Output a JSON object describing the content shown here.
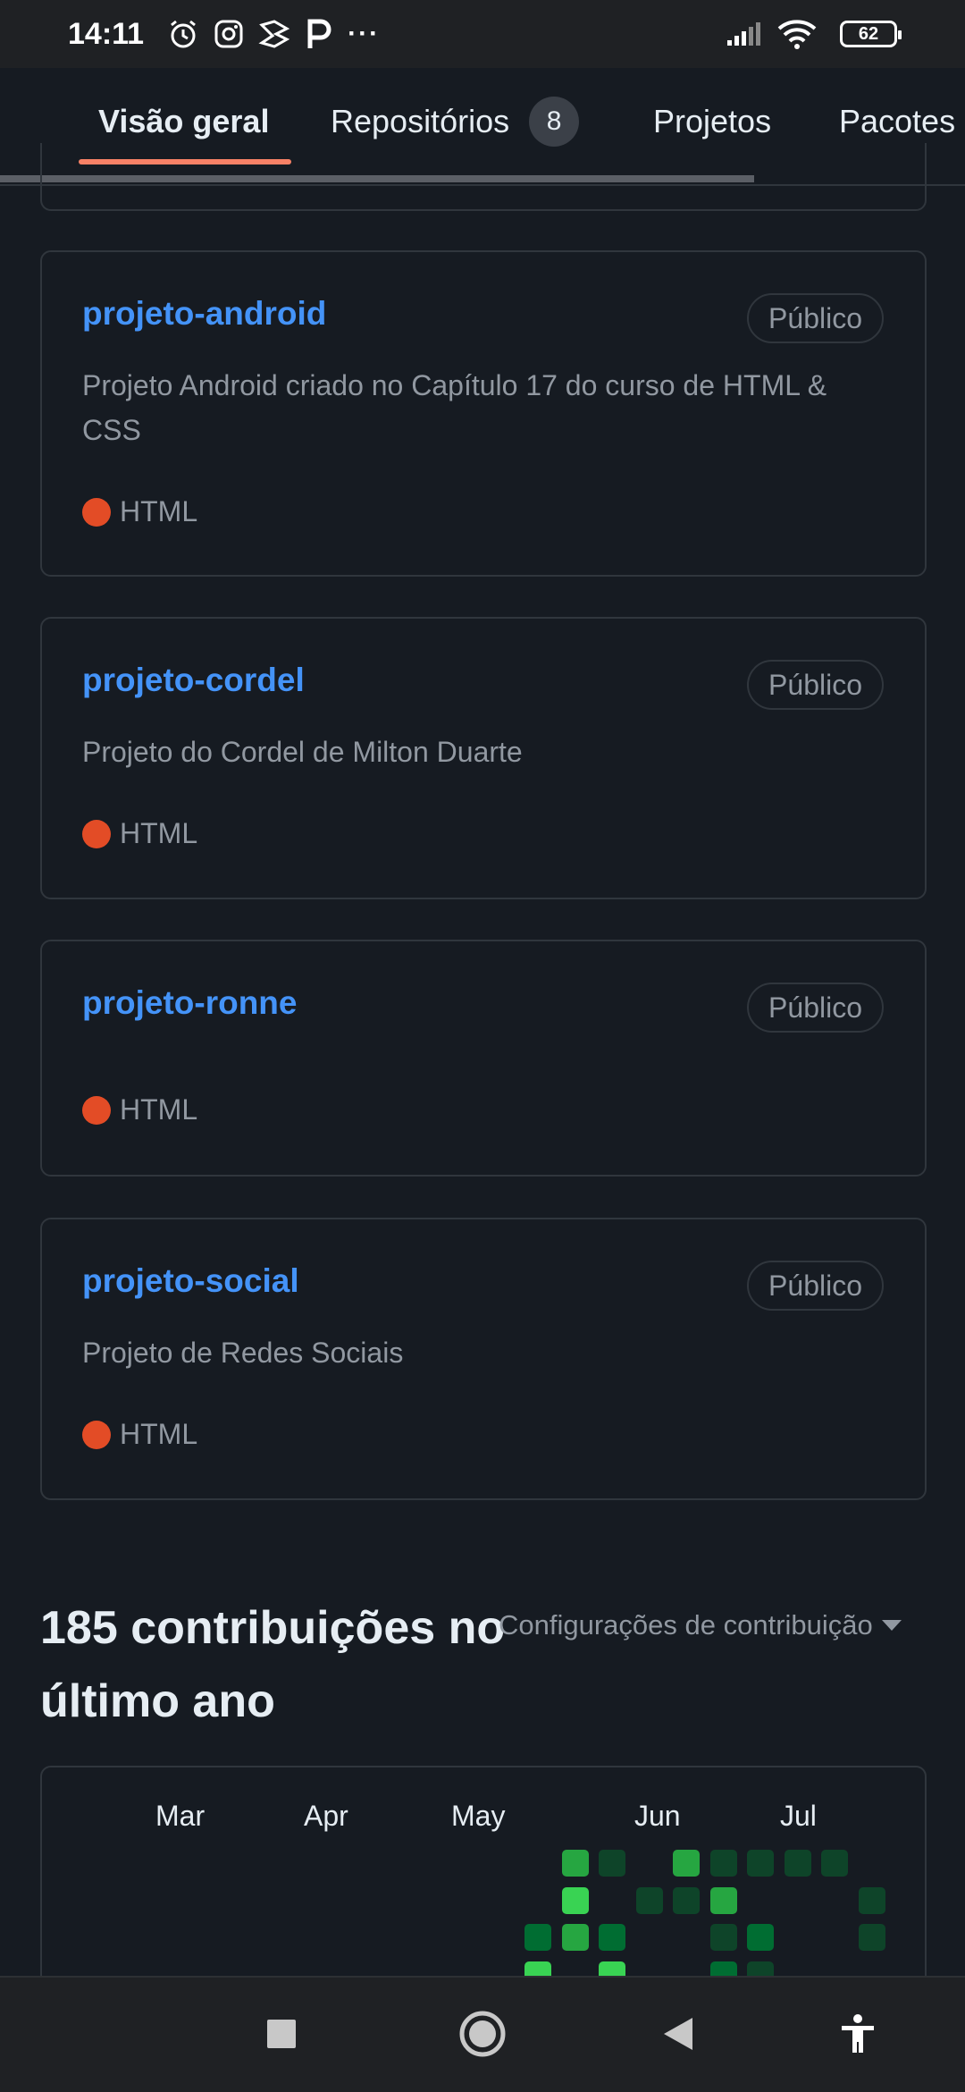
{
  "status_bar": {
    "time": "14:11",
    "left_icons": [
      "alarm-icon",
      "instagram-icon",
      "app-icon",
      "p-icon",
      "more-icon"
    ],
    "more": "···",
    "battery": "62"
  },
  "tabs": [
    {
      "label": "Visão geral",
      "active": true
    },
    {
      "label": "Repositórios",
      "count": "8"
    },
    {
      "label": "Projetos"
    },
    {
      "label": "Pacotes"
    }
  ],
  "repos": [
    {
      "name": "projeto-android",
      "visibility": "Público",
      "description": "Projeto Android criado no Capítulo 17 do curso de HTML & CSS",
      "language": "HTML"
    },
    {
      "name": "projeto-cordel",
      "visibility": "Público",
      "description": "Projeto do Cordel de Milton Duarte",
      "language": "HTML"
    },
    {
      "name": "projeto-ronne",
      "visibility": "Público",
      "description": "",
      "language": "HTML"
    },
    {
      "name": "projeto-social",
      "visibility": "Público",
      "description": "Projeto de Redes Sociais",
      "language": "HTML"
    }
  ],
  "language_color": "#e34c26",
  "contributions": {
    "title": "185 contribuições no último ano",
    "settings_label": "Configurações de contribuição",
    "months": [
      "Mar",
      "Apr",
      "May",
      "Jun",
      "Jul"
    ]
  },
  "nav_bar": {
    "buttons": [
      "recents-button",
      "home-button",
      "back-button",
      "accessibility-button"
    ]
  }
}
